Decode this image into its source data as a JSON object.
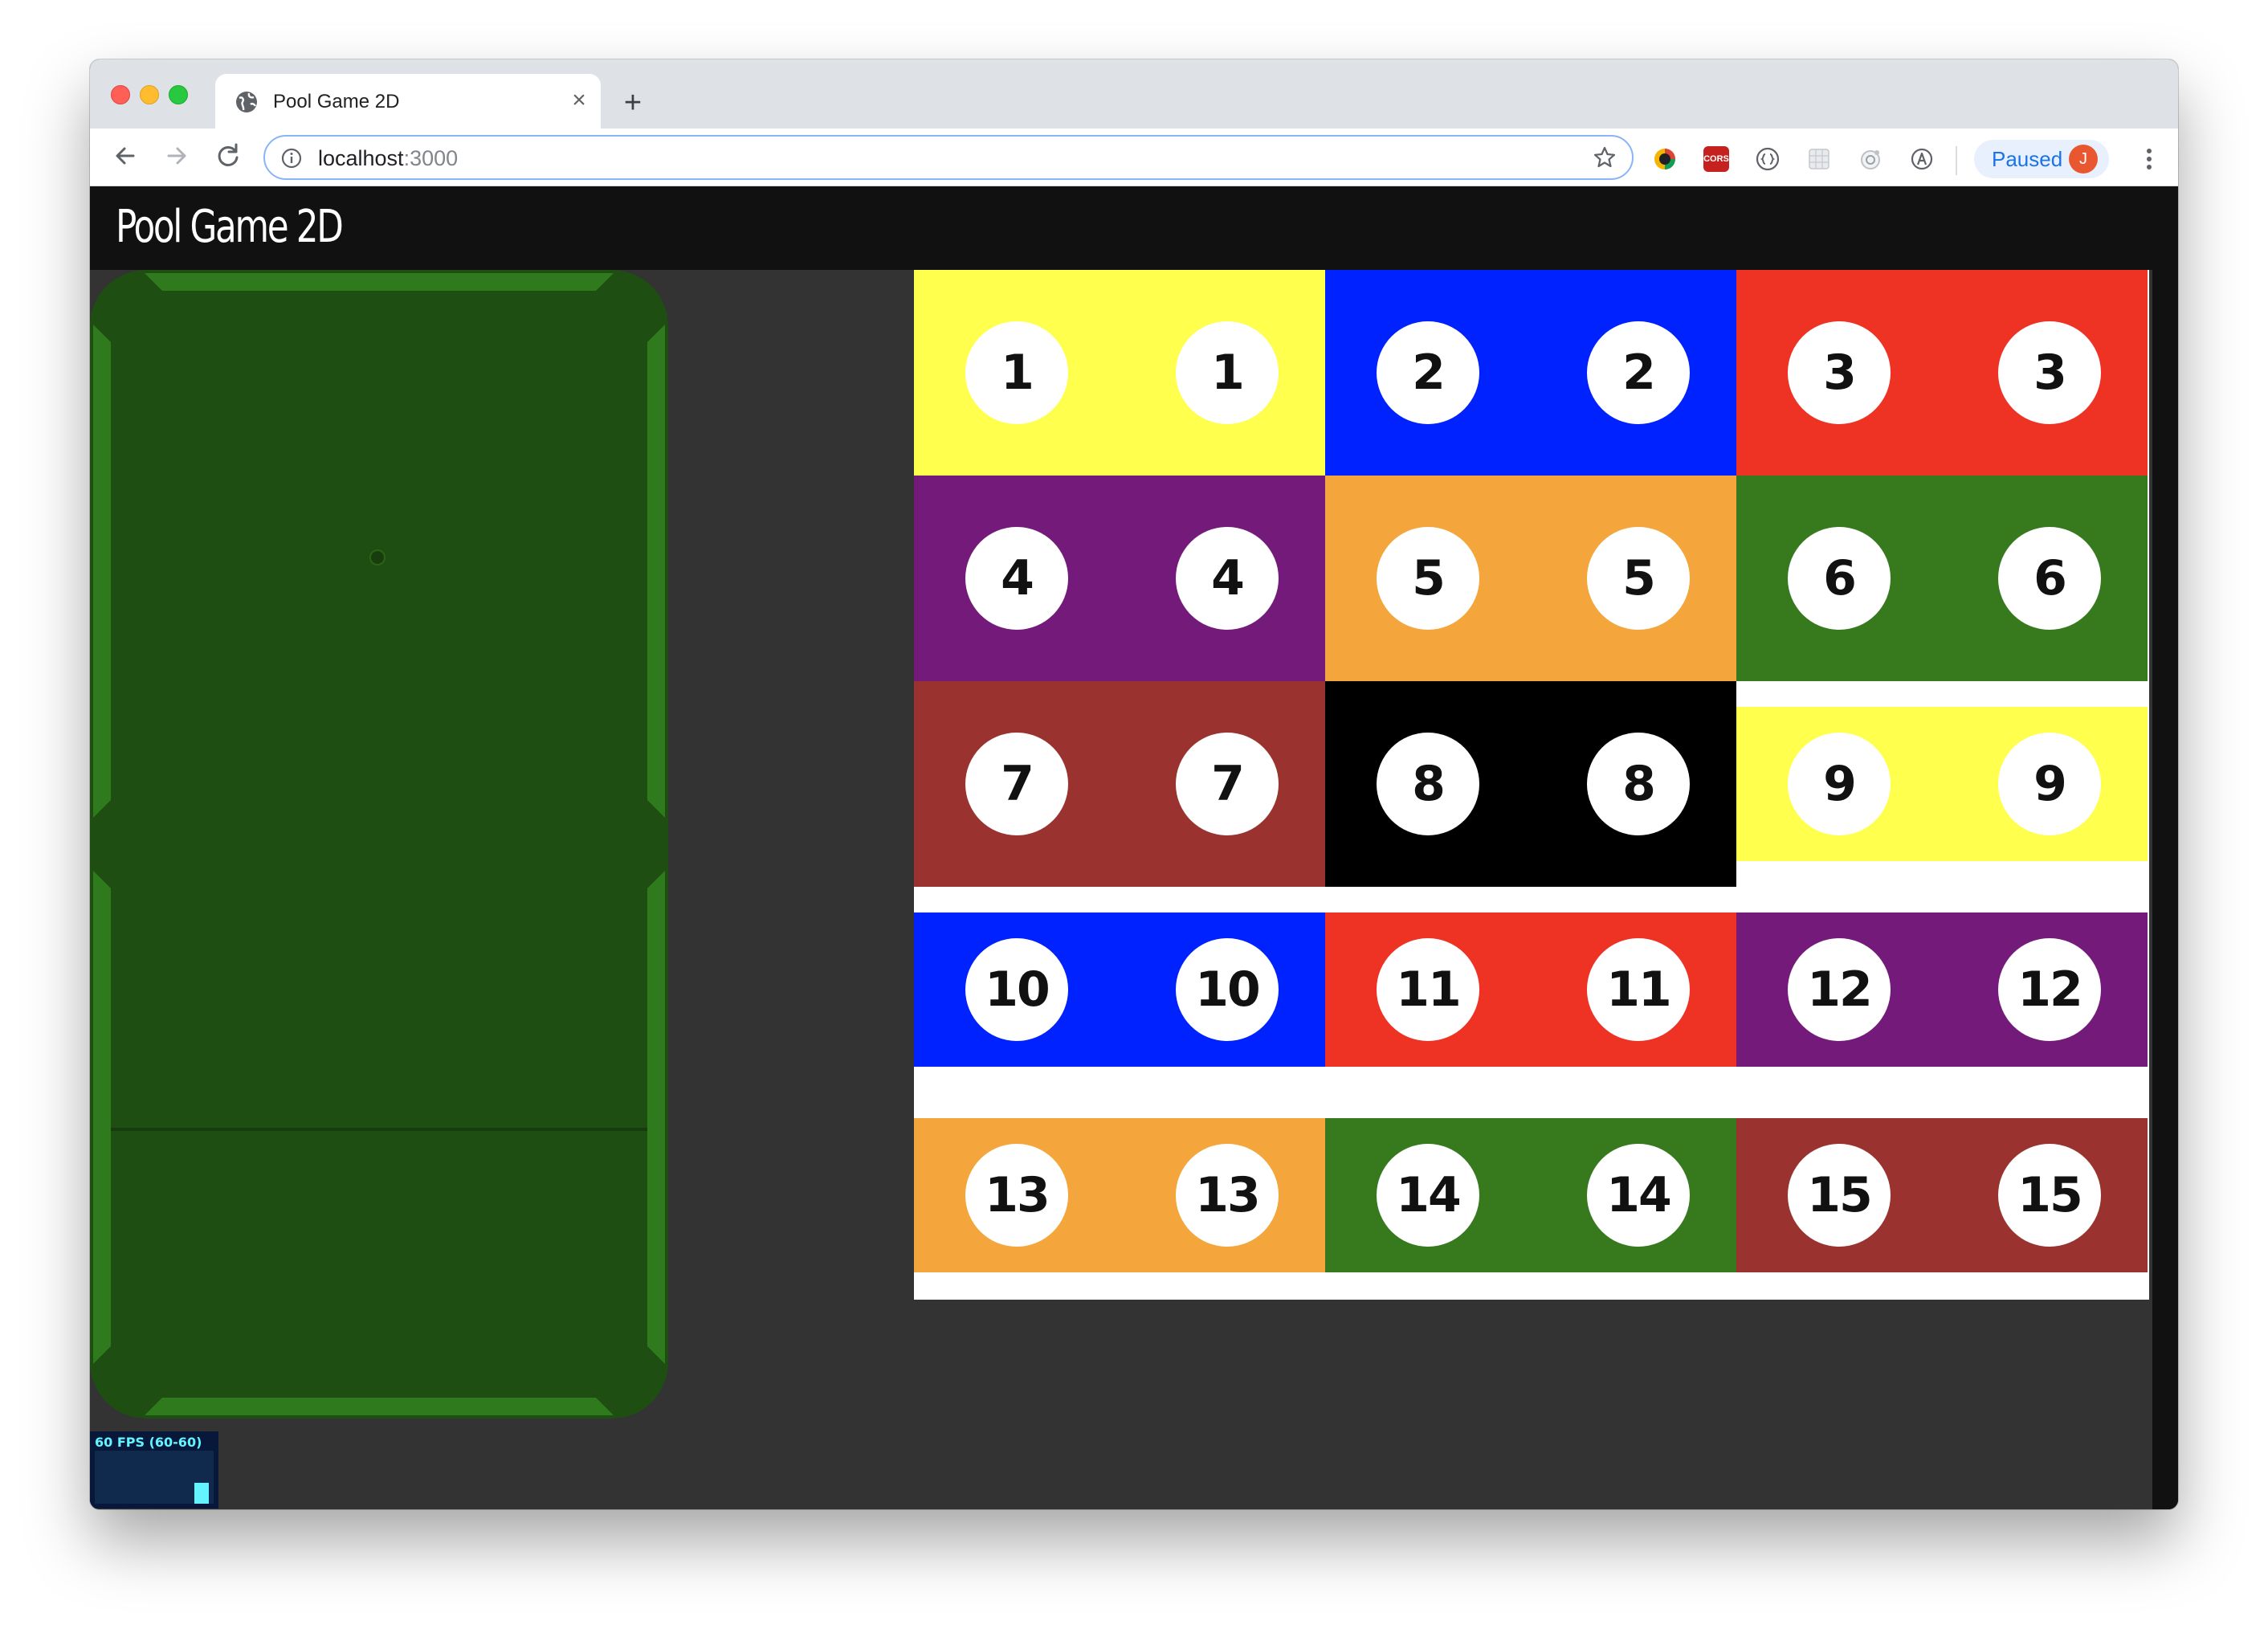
{
  "browser": {
    "tab_title": "Pool Game 2D",
    "close_tab_glyph": "×",
    "new_tab_glyph": "+",
    "url_host": "localhost",
    "url_port": ":3000",
    "profile_status": "Paused",
    "profile_initial": "J",
    "cors_extension_label": "CORS",
    "icons": [
      "globe-icon",
      "close-icon",
      "plus-icon",
      "back-arrow-icon",
      "forward-arrow-icon",
      "reload-icon",
      "info-icon",
      "star-icon",
      "kebab-menu-icon"
    ]
  },
  "page": {
    "title": "Pool Game 2D",
    "fps_label": "60 FPS (60-60)",
    "fps_value": 60,
    "fps_bar_fraction": 0.4
  },
  "balls": [
    {
      "n": "1",
      "color": "#ffff4d",
      "row": 0,
      "col": 0,
      "striped": false
    },
    {
      "n": "2",
      "color": "#0022ff",
      "row": 0,
      "col": 1,
      "striped": false
    },
    {
      "n": "3",
      "color": "#ee3224",
      "row": 0,
      "col": 2,
      "striped": false
    },
    {
      "n": "4",
      "color": "#741a7a",
      "row": 1,
      "col": 0,
      "striped": false
    },
    {
      "n": "5",
      "color": "#f4a63c",
      "row": 1,
      "col": 1,
      "striped": false
    },
    {
      "n": "6",
      "color": "#377a1e",
      "row": 1,
      "col": 2,
      "striped": false
    },
    {
      "n": "7",
      "color": "#9a3330",
      "row": 2,
      "col": 0,
      "striped": false
    },
    {
      "n": "8",
      "color": "#000000",
      "row": 2,
      "col": 1,
      "striped": false
    },
    {
      "n": "9",
      "color": "#ffff4d",
      "row": 2,
      "col": 2,
      "striped": true
    },
    {
      "n": "10",
      "color": "#0022ff",
      "row": 3,
      "col": 0,
      "striped": true
    },
    {
      "n": "11",
      "color": "#ee3224",
      "row": 3,
      "col": 1,
      "striped": true
    },
    {
      "n": "12",
      "color": "#741a7a",
      "row": 3,
      "col": 2,
      "striped": true
    },
    {
      "n": "13",
      "color": "#f4a63c",
      "row": 4,
      "col": 0,
      "striped": true
    },
    {
      "n": "14",
      "color": "#377a1e",
      "row": 4,
      "col": 1,
      "striped": true
    },
    {
      "n": "15",
      "color": "#9a3330",
      "row": 4,
      "col": 2,
      "striped": true
    }
  ],
  "colors": {
    "table_felt": "#1f4e13",
    "table_cushion": "#2f7a1d",
    "page_bg": "#333333",
    "header_bg": "#111111"
  }
}
